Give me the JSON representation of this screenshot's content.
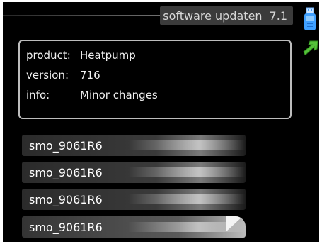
{
  "header": {
    "title": "software updaten",
    "code": "7.1"
  },
  "info": {
    "product_label": "product:",
    "product_value": "Heatpump",
    "version_label": "version:",
    "version_value": "716",
    "info_label": "info:",
    "info_value": "Minor changes"
  },
  "files": [
    {
      "name": "smo_9061R6"
    },
    {
      "name": "smo_9061R6"
    },
    {
      "name": "smo_9061R6"
    },
    {
      "name": "smo_9061R6"
    }
  ],
  "icons": {
    "usb": "usb-stick-icon",
    "back": "back-arrow-icon"
  },
  "colors": {
    "background": "#000000",
    "title_bar": "#3b3b3b",
    "usb_blue": "#3fa0ff",
    "arrow_green": "#55c23a"
  }
}
